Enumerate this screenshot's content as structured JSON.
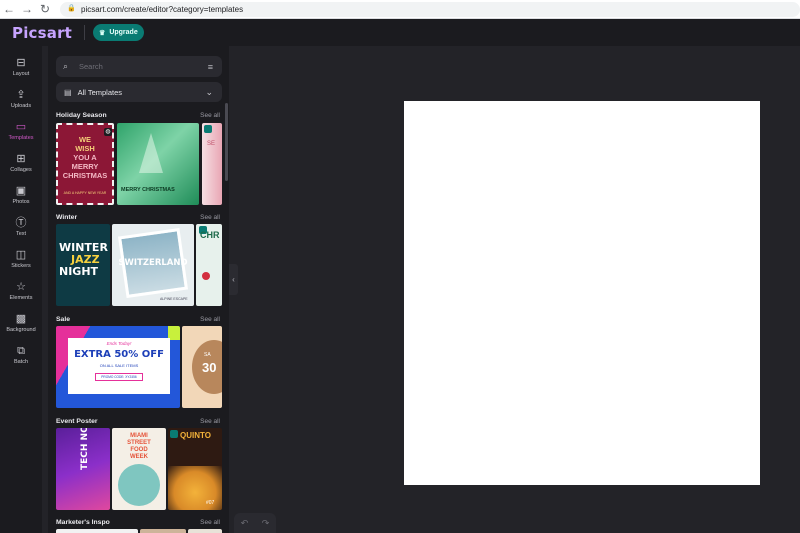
{
  "browser": {
    "url": "picsart.com/create/editor?category=templates"
  },
  "app": {
    "logo": "Picsart",
    "upgrade_label": "Upgrade"
  },
  "rail": [
    {
      "label": "Layout",
      "icon": "layout-icon",
      "active": false
    },
    {
      "label": "Uploads",
      "icon": "upload-icon",
      "active": false
    },
    {
      "label": "Templates",
      "icon": "templates-icon",
      "active": true
    },
    {
      "label": "Collages",
      "icon": "collages-icon",
      "active": false
    },
    {
      "label": "Photos",
      "icon": "photos-icon",
      "active": false
    },
    {
      "label": "Text",
      "icon": "text-icon",
      "active": false
    },
    {
      "label": "Stickers",
      "icon": "stickers-icon",
      "active": false
    },
    {
      "label": "Elements",
      "icon": "elements-icon",
      "active": false
    },
    {
      "label": "Background",
      "icon": "background-icon",
      "active": false
    },
    {
      "label": "Batch",
      "icon": "batch-icon",
      "active": false
    }
  ],
  "panel": {
    "search_placeholder": "Search",
    "category": "All Templates",
    "see_all": "See all",
    "sections": [
      {
        "title": "Holiday Season",
        "cards": [
          {
            "lines": [
              "WE",
              "WISH",
              "YOU A",
              "MERRY",
              "CHRISTMAS"
            ],
            "sub": "AND A HAPPY NEW YEAR"
          },
          {
            "lines": [
              "MERRY CHRISTMAS"
            ]
          },
          {
            "lines": [
              "SE"
            ]
          }
        ]
      },
      {
        "title": "Winter",
        "cards": [
          {
            "lines": [
              "WINTER",
              "JAZZ",
              "NIGHT"
            ]
          },
          {
            "lines": [
              "SWITZERLAND"
            ],
            "sub": "ALPINE ESCAPE"
          },
          {
            "lines": [
              "CHR"
            ]
          }
        ]
      },
      {
        "title": "Sale",
        "cards": [
          {
            "lines": [
              "Ends Today!",
              "EXTRA 50% OFF",
              "ON ALL SALE ITEMS"
            ],
            "sub": "PROMO CODE: XYZ456"
          },
          {
            "lines": [
              "SA",
              "30"
            ]
          }
        ]
      },
      {
        "title": "Event Poster",
        "cards": [
          {
            "lines": [
              "TECH NOIR"
            ]
          },
          {
            "lines": [
              "MIAMI",
              "STREET",
              "FOOD",
              "WEEK"
            ]
          },
          {
            "lines": [
              "QUINTO"
            ],
            "sub": "#07"
          }
        ]
      },
      {
        "title": "Marketer's Inspo",
        "cards": []
      }
    ]
  },
  "colors": {
    "accent": "#cf58c7",
    "upgrade": "#0a7b73",
    "logo": "#c7a4ff"
  }
}
